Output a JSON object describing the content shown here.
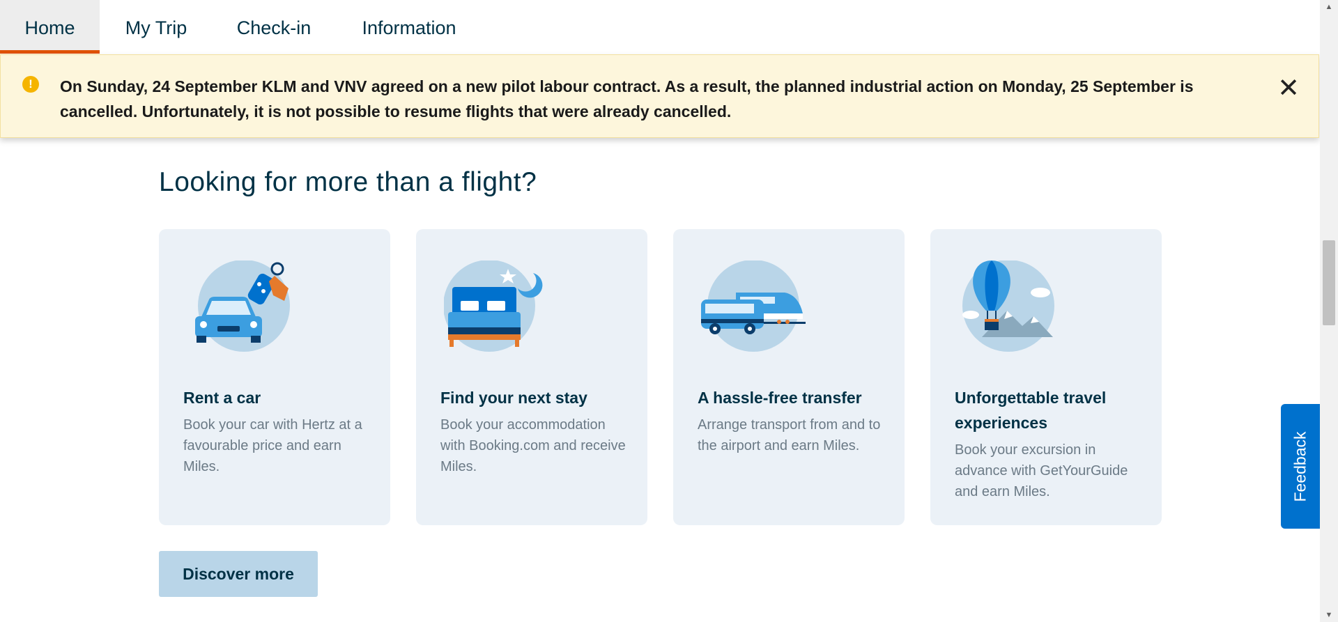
{
  "nav": {
    "tabs": [
      {
        "label": "Home",
        "active": true
      },
      {
        "label": "My Trip",
        "active": false
      },
      {
        "label": "Check-in",
        "active": false
      },
      {
        "label": "Information",
        "active": false
      }
    ]
  },
  "alert": {
    "icon": "warning-icon",
    "message": "On Sunday, 24 September KLM and VNV agreed on a new pilot labour contract. As a result, the planned industrial action on Monday, 25 September is cancelled. Unfortunately, it is not possible to resume flights that were already cancelled.",
    "close_icon": "close-icon"
  },
  "section": {
    "heading": "Looking for more than a flight?",
    "cards": [
      {
        "title": "Rent a car",
        "description": "Book your car with Hertz at a favourable price and earn Miles.",
        "icon": "car-rental-illustration"
      },
      {
        "title": "Find your next stay",
        "description": "Book your accommodation with Booking.com and receive Miles.",
        "icon": "bed-illustration"
      },
      {
        "title": "A hassle-free transfer",
        "description": "Arrange transport from and to the airport and earn Miles.",
        "icon": "transfer-illustration"
      },
      {
        "title": "Unforgettable travel experiences",
        "description": "Book your excursion in advance with GetYourGuide and earn Miles.",
        "icon": "hot-air-balloon-illustration"
      }
    ],
    "discover_button": "Discover more"
  },
  "feedback": {
    "label": "Feedback"
  },
  "colors": {
    "active_tab_underline": "#e05206",
    "alert_background": "#fdf6dc",
    "alert_icon": "#f5b400",
    "card_background": "#ebf1f7",
    "button_background": "#b9d5e8",
    "feedback_background": "#0071cd",
    "heading_text": "#003145"
  }
}
